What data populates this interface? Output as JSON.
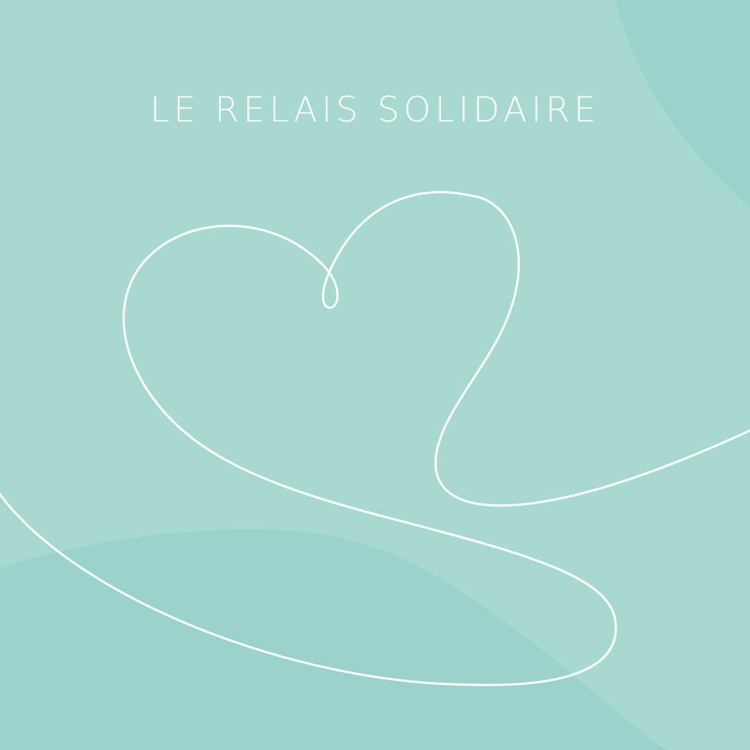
{
  "title": "LE RELAIS SOLIDAIRE",
  "colors": {
    "background": "#a7d9d1",
    "blob": "#99d3c9",
    "line": "#ffffff",
    "text": "#ffffff"
  },
  "icons": {
    "heart_line": "heart-line-icon"
  }
}
